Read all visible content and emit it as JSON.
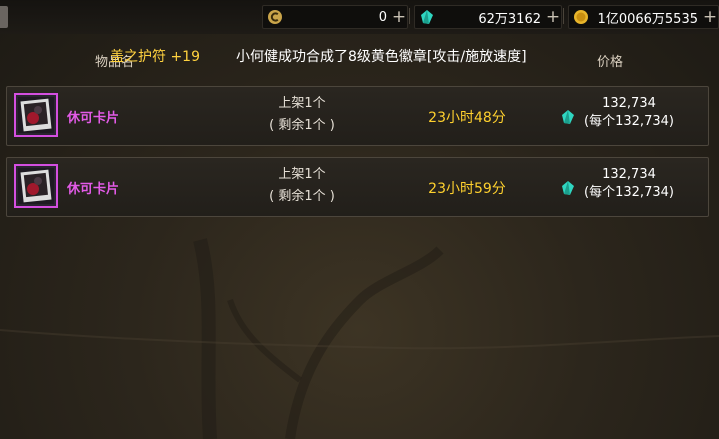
{
  "currency": [
    {
      "icon": "c-coin-icon",
      "value": "0",
      "plus": "+"
    },
    {
      "icon": "crystal-icon",
      "value": "62万3162",
      "plus": "+"
    },
    {
      "icon": "gold-coin-icon",
      "value": "1亿0066万5535",
      "plus": "+"
    }
  ],
  "header": {
    "item_label": "物品名",
    "price_label": "价格"
  },
  "overlay": {
    "enchant_text": "盖之护符 +19",
    "description": "小何健成功合成了8级黄色徽章[攻击/施放速度]"
  },
  "listings": [
    {
      "name": "休可卡片",
      "listed": "上架1个",
      "remaining": "( 剩余1个 )",
      "time_left": "23小时48分",
      "price_total": "132,734",
      "price_each": "(每个132,734)"
    },
    {
      "name": "休可卡片",
      "listed": "上架1个",
      "remaining": "( 剩余1个 )",
      "time_left": "23小时59分",
      "price_total": "132,734",
      "price_each": "(每个132,734)"
    }
  ],
  "colors": {
    "item_name": "#e35be8",
    "time": "#ffd12e",
    "enchant": "#ffd23f"
  }
}
